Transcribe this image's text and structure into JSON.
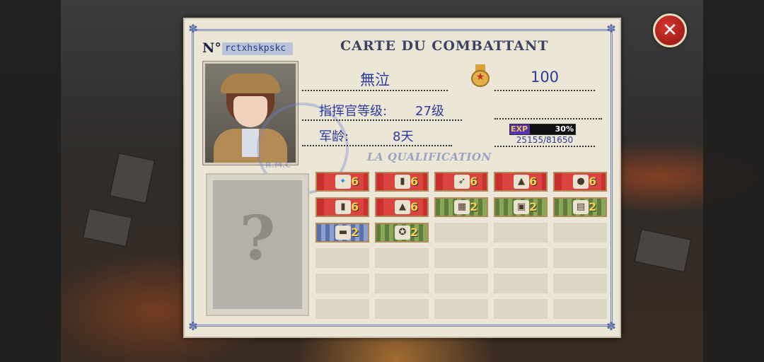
{
  "card": {
    "title": "CARTE DU COMBATTANT",
    "number_label": "N°",
    "number_value": "rctxhskpskc",
    "name": "無泣",
    "score": "100",
    "rank_label": "指挥官等级:",
    "rank_value": "27级",
    "age_label": "军龄:",
    "age_value": "8天",
    "exp_label": "EXP",
    "exp_percent_text": "30%",
    "exp_fraction": 0.3,
    "exp_numbers": "25155/81650",
    "qualification_title": "LA QUALIFICATION",
    "placeholder_glyph": "?",
    "stamp_text": "R.M.C"
  },
  "qualifications": [
    {
      "style": "red",
      "icon": "bullet-icon",
      "glyph": "🔹",
      "count": "6"
    },
    {
      "style": "red",
      "icon": "shell-icon",
      "glyph": "▮",
      "count": "6"
    },
    {
      "style": "red",
      "icon": "rocket-icon",
      "glyph": "➶",
      "count": "6"
    },
    {
      "style": "red",
      "icon": "cannon-shell-icon",
      "glyph": "▲",
      "count": "6"
    },
    {
      "style": "red",
      "icon": "bomb-icon",
      "glyph": "●",
      "count": "6"
    },
    {
      "style": "red",
      "icon": "shell-2-icon",
      "glyph": "▮",
      "count": "6"
    },
    {
      "style": "red",
      "icon": "shell-3-icon",
      "glyph": "▲",
      "count": "6"
    },
    {
      "style": "green",
      "icon": "map-icon",
      "glyph": "▦",
      "count": "2"
    },
    {
      "style": "green",
      "icon": "blueprint-icon",
      "glyph": "▣",
      "count": "2"
    },
    {
      "style": "green",
      "icon": "document-icon",
      "glyph": "▤",
      "count": "2"
    },
    {
      "style": "blue",
      "icon": "tank-icon",
      "glyph": "▬",
      "count": "2"
    },
    {
      "style": "green",
      "icon": "badge-icon",
      "glyph": "✪",
      "count": "2"
    }
  ],
  "close_label": "✕"
}
